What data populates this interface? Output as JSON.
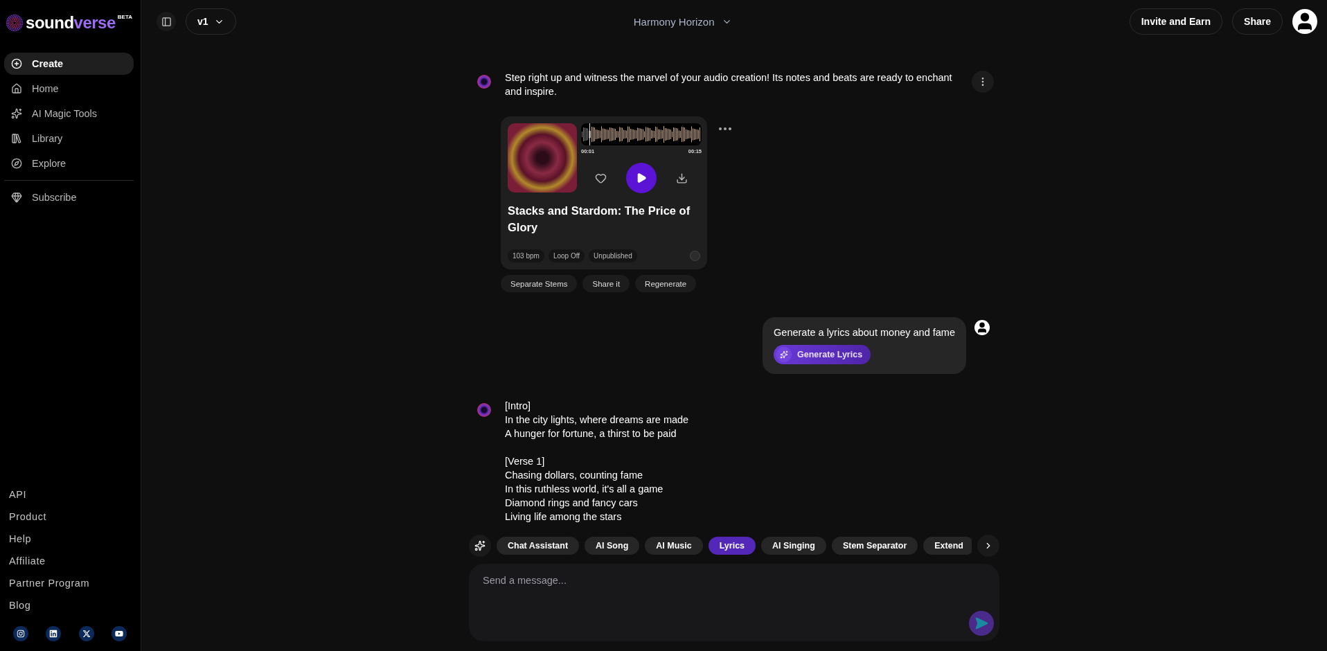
{
  "logo": {
    "word_a": "sound",
    "word_b": "verse",
    "badge": "BETA"
  },
  "sidebar": {
    "nav": [
      {
        "label": "Create",
        "selected": true
      },
      {
        "label": "Home",
        "selected": false
      },
      {
        "label": "AI Magic Tools",
        "selected": false
      },
      {
        "label": "Library",
        "selected": false
      },
      {
        "label": "Explore",
        "selected": false
      }
    ],
    "subscribe": "Subscribe",
    "footer_links": [
      "API",
      "Product",
      "Help",
      "Affiliate",
      "Partner Program",
      "Blog"
    ]
  },
  "header": {
    "version": "v1",
    "project_title": "Harmony Horizon",
    "buttons": [
      "Invite and Earn",
      "Share"
    ]
  },
  "messages": [
    {
      "kind": "bot_track",
      "text": "Step right up and witness the marvel of your audio creation! Its notes and beats are ready to enchant and inspire.",
      "track": {
        "title": "Stacks and Stardom: The Price of Glory",
        "current_time": "00:01",
        "duration": "00:15",
        "level": 0.07,
        "tags": [
          "103 bpm",
          "Loop Off",
          "Unpublished"
        ]
      },
      "actions": [
        "Separate Stems",
        "Share it",
        "Regenerate"
      ]
    },
    {
      "kind": "user",
      "text": "Generate a lyrics about money and fame",
      "action": "Generate Lyrics"
    },
    {
      "kind": "bot_lyrics",
      "stanzas": [
        [
          "[Intro]",
          "In the city lights, where dreams are made",
          "A hunger for fortune, a thirst to be paid"
        ],
        [
          "[Verse 1]",
          "Chasing dollars, counting fame",
          "In this ruthless world, it's all a game",
          "Diamond rings and fancy cars",
          "Living life among the stars"
        ]
      ]
    }
  ],
  "chips": [
    {
      "label": "Chat Assistant",
      "selected": false
    },
    {
      "label": "AI Song",
      "selected": false
    },
    {
      "label": "AI Music",
      "selected": false
    },
    {
      "label": "Lyrics",
      "selected": true
    },
    {
      "label": "AI Singing",
      "selected": false
    },
    {
      "label": "Stem Separator",
      "selected": false
    },
    {
      "label": "Extend",
      "selected": false
    }
  ],
  "composer": {
    "placeholder": "Send a message..."
  }
}
